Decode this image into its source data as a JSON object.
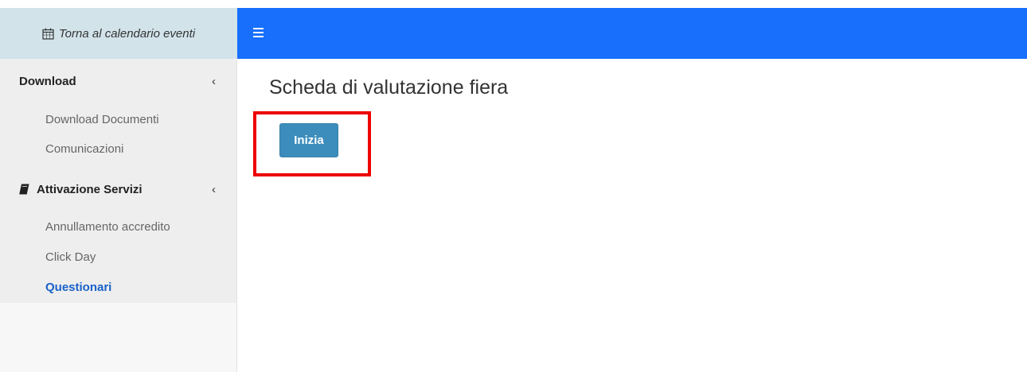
{
  "sidebar": {
    "back_link": {
      "label": "Torna al calendario eventi",
      "icon": "calendar-icon"
    },
    "sections": [
      {
        "label": "Download",
        "chevron": "‹",
        "items": [
          {
            "label": "Download Documenti"
          },
          {
            "label": "Comunicazioni"
          }
        ]
      },
      {
        "label": "Attivazione Servizi",
        "icon": "book-icon",
        "chevron": "‹",
        "items": [
          {
            "label": "Annullamento accredito"
          },
          {
            "label": "Click Day"
          },
          {
            "label": "Questionari",
            "active": true
          }
        ]
      }
    ]
  },
  "topbar": {
    "icon": "hamburger-menu-icon",
    "color": "#176ffb"
  },
  "main": {
    "title": "Scheda di valutazione fiera",
    "start_button": {
      "label": "Inizia",
      "color": "#3c8dbc"
    },
    "highlight_color": "#ee0000"
  }
}
